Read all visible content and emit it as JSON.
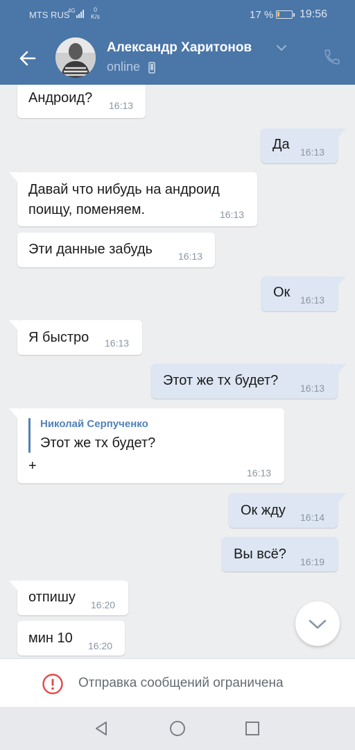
{
  "status_bar": {
    "carrier": "MTS RUS",
    "network": "4G",
    "speed_value": "0",
    "speed_unit": "K/s",
    "battery_percent": "17 %",
    "battery_level": 0.17,
    "time": "19:56"
  },
  "header": {
    "contact_name": "Александр Харитонов",
    "status": "online",
    "icons": [
      "back-arrow-icon",
      "chevron-down-icon",
      "phone-icon",
      "call-icon"
    ]
  },
  "messages": [
    {
      "dir": "in",
      "text": "Андроид?",
      "time": "16:13"
    },
    {
      "dir": "out",
      "text": "Да",
      "time": "16:13"
    },
    {
      "dir": "in",
      "text": "Давай что нибудь на андроид поищу, поменяем.",
      "time": "16:13"
    },
    {
      "dir": "in",
      "text": "Эти данные забудь",
      "time": "16:13"
    },
    {
      "dir": "out",
      "text": "Ок",
      "time": "16:13"
    },
    {
      "dir": "in",
      "text": "Я быстро",
      "time": "16:13"
    },
    {
      "dir": "out",
      "text": "Этот же тх будет?",
      "time": "16:13"
    },
    {
      "dir": "in",
      "reply_author": "Николай Серпученко",
      "reply_text": "Этот же тх будет?",
      "text": "+",
      "time": "16:13"
    },
    {
      "dir": "out",
      "text": "Ок жду",
      "time": "16:14"
    },
    {
      "dir": "out",
      "text": "Вы всё?",
      "time": "16:19"
    },
    {
      "dir": "in",
      "text": "отпишу",
      "time": "16:20"
    },
    {
      "dir": "in",
      "text": "мин 10",
      "time": "16:20"
    }
  ],
  "restriction": {
    "text": "Отправка сообщений ограничена",
    "icon": "warning-icon",
    "color": "#e64646"
  },
  "colors": {
    "header": "#4a76a8",
    "outgoing_bubble": "#dde6f2",
    "incoming_bubble": "#ffffff",
    "chat_background": "#edeef0"
  },
  "nav": {
    "icons": [
      "nav-back-icon",
      "nav-home-icon",
      "nav-recents-icon"
    ]
  }
}
